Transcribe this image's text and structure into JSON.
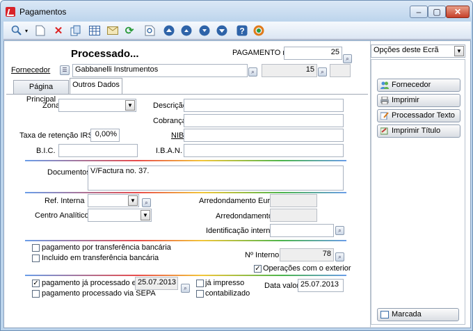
{
  "window": {
    "title": "Pagamentos",
    "minimize": "–",
    "maximize": "▢",
    "close": "✕"
  },
  "toolbar": {
    "icons": [
      "search-icon",
      "new-document-icon",
      "delete-icon",
      "copy-icon",
      "table-icon",
      "mail-icon",
      "refresh-icon",
      "preview-icon",
      "first-record-icon",
      "previous-record-icon",
      "next-record-icon",
      "last-record-icon",
      "help-icon",
      "exit-icon"
    ]
  },
  "header": {
    "status": "Processado...",
    "payment_label": "PAGAMENTO nº",
    "payment_number": "25"
  },
  "supplier": {
    "label": "Fornecedor",
    "name": "Gabbanelli Instrumentos",
    "number": "15"
  },
  "tabs": [
    {
      "label": "Página Principal"
    },
    {
      "label": "Outros Dados"
    }
  ],
  "form": {
    "zona_label": "Zona",
    "zona_value": "",
    "descricao_label": "Descrição",
    "descricao_value": "",
    "cobranca_label": "Cobrança",
    "cobranca_value": "",
    "taxa_label": "Taxa de retenção IRS",
    "taxa_value": "0,00%",
    "nib_label": "NIB",
    "nib_value": "",
    "bic_label": "B.I.C.",
    "bic_value": "",
    "iban_label": "I.B.A.N.",
    "iban_value": "",
    "documentos_label": "Documentos",
    "documentos_value": "V/Factura no. 37.",
    "ref_interna_label": "Ref. Interna",
    "ref_interna_value": "",
    "arred_euros_label": "Arredondamento Euros",
    "arred_euros_value": "",
    "centro_label": "Centro Analítico",
    "centro_value": "",
    "arred_label": "Arredondamento",
    "arred_value": "",
    "ident_label": "Identificação interna",
    "ident_value": "",
    "transf_label": "pagamento por transferência bancária",
    "transf_checked": false,
    "incluido_label": "Incluido em transferência bancária",
    "incluido_checked": false,
    "num_interno_label": "Nº Interno",
    "num_interno_value": "78",
    "exterior_label": "Operações com o exterior",
    "exterior_checked": true,
    "processado_label": "pagamento já processado em",
    "processado_checked": true,
    "processado_date": "25.07.2013",
    "sepa_label": "pagamento processado via SEPA",
    "sepa_checked": false,
    "impresso_label": "já impresso",
    "impresso_checked": false,
    "contabilizado_label": "contabilizado",
    "contabilizado_checked": false,
    "data_valor_label": "Data valor",
    "data_valor_value": "25.07.2013"
  },
  "side": {
    "options_label": "Opções deste Ecrã",
    "buttons": [
      {
        "label": "Fornecedor"
      },
      {
        "label": "Imprimir"
      },
      {
        "label": "Processador Texto"
      },
      {
        "label": "Imprimir Título"
      }
    ],
    "marcada_label": "Marcada"
  }
}
